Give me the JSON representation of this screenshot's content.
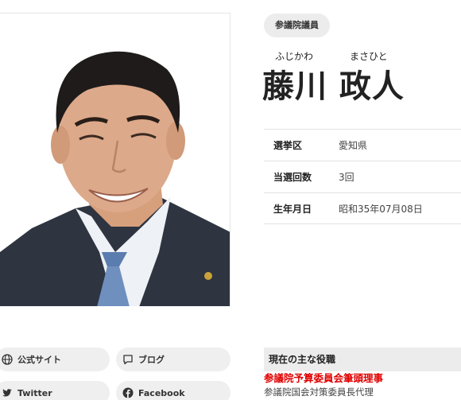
{
  "member": {
    "badge": "参議院議員",
    "furigana_sei": "ふじかわ",
    "furigana_mei": "まさひと",
    "name": "藤川 政人"
  },
  "profile": [
    {
      "label": "選挙区",
      "value": "愛知県"
    },
    {
      "label": "当選回数",
      "value": "3回"
    },
    {
      "label": "生年月日",
      "value": "昭和35年07月08日"
    }
  ],
  "links": {
    "site": "公式サイト",
    "blog": "ブログ",
    "twitter": "Twitter",
    "facebook": "Facebook"
  },
  "roles": {
    "header": "現在の主な役職",
    "main": "参議院予算委員会筆頭理事",
    "sub": "参議院国会対策委員長代理"
  },
  "colors": {
    "accent_red": "#e00000",
    "button_bg": "#efefef",
    "divider": "#e2e2e2"
  },
  "icons": {
    "site": "globe-icon",
    "blog": "speech-bubble-icon",
    "twitter": "twitter-bird-icon",
    "facebook": "facebook-icon"
  }
}
